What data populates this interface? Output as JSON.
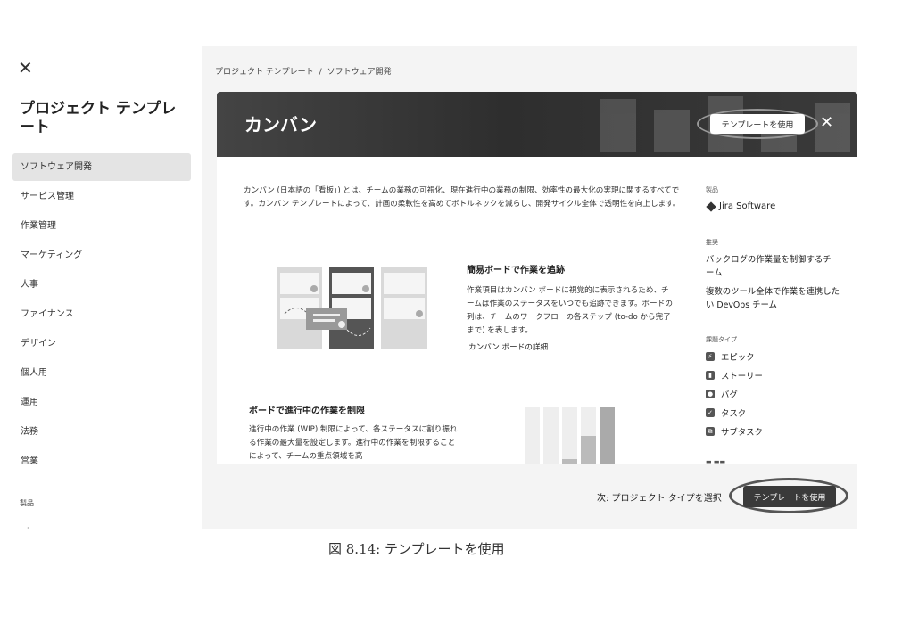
{
  "sidebar": {
    "title": "プロジェクト テンプレート",
    "items": [
      {
        "label": "ソフトウェア開発",
        "active": true
      },
      {
        "label": "サービス管理"
      },
      {
        "label": "作業管理"
      },
      {
        "label": "マーケティング"
      },
      {
        "label": "人事"
      },
      {
        "label": "ファイナンス"
      },
      {
        "label": "デザイン"
      },
      {
        "label": "個人用"
      },
      {
        "label": "運用"
      },
      {
        "label": "法務"
      },
      {
        "label": "営業"
      }
    ],
    "section_label": "製品"
  },
  "breadcrumb": {
    "parent": "プロジェクト テンプレート",
    "separator": "/",
    "current": "ソフトウェア開発"
  },
  "modal": {
    "title": "カンバン",
    "use_template_label": "テンプレートを使用",
    "intro": "カンバン (日本語の「看板」) とは、チームの業務の可視化、現在進行中の業務の制限、効率性の最大化の実現に関するすべてです。カンバン テンプレートによって、計画の柔軟性を高めてボトルネックを減らし、開発サイクル全体で透明性を向上します。",
    "feature1": {
      "title": "簡易ボードで作業を追跡",
      "text": "作業項目はカンバン ボードに視覚的に表示されるため、チームは作業のステータスをいつでも追跡できます。ボードの列は、チームのワークフローの各ステップ (to-do から完了まで) を表します。",
      "link": "カンバン ボードの詳細"
    },
    "feature2": {
      "title": "ボードで進行中の作業を制限",
      "text": "進行中の作業 (WIP) 制限によって、各ステータスに割り振れる作業の最大量を設定します。進行中の作業を制限することによって、チームの重点領域を高"
    },
    "right": {
      "product_label": "製品",
      "product": "Jira Software",
      "recommended_label": "推奨",
      "recommended": [
        "バックログの作業量を制御するチーム",
        "複数のツール全体で作業を連携したい DevOps チーム"
      ],
      "issue_types_label": "課題タイプ",
      "issue_types": [
        {
          "label": "エピック",
          "icon": "lightning-icon"
        },
        {
          "label": "ストーリー",
          "icon": "bookmark-icon"
        },
        {
          "label": "バグ",
          "icon": "bug-icon"
        },
        {
          "label": "タスク",
          "icon": "checkbox-icon"
        },
        {
          "label": "サブタスク",
          "icon": "subtask-icon"
        }
      ]
    },
    "footer": {
      "next_text": "次: プロジェクト タイプを選択",
      "use_template_label": "テンプレートを使用"
    }
  },
  "caption": "図 8.14: テンプレートを使用",
  "colors": {
    "header_dark": "#333333",
    "button_dark": "#3a3a3a",
    "active_item": "#e4e4e4"
  }
}
